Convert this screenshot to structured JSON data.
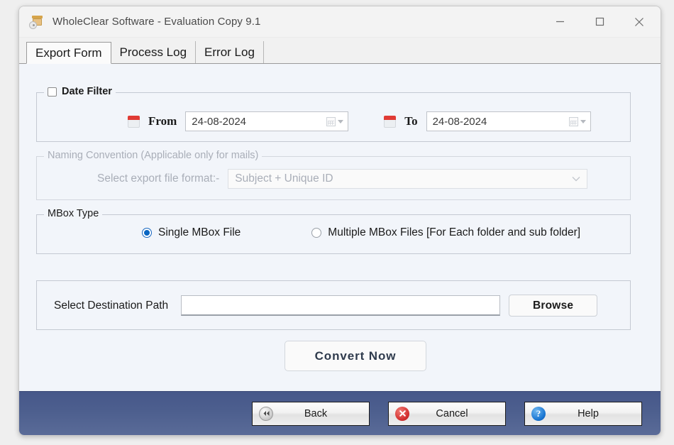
{
  "window": {
    "title": "WholeClear Software - Evaluation Copy 9.1",
    "app_icon": "archive-box-disc-icon",
    "controls": {
      "minimize": "minimize-icon",
      "maximize": "maximize-icon",
      "close": "close-icon"
    }
  },
  "tabs": [
    {
      "label": "Export Form",
      "active": true
    },
    {
      "label": "Process Log",
      "active": false
    },
    {
      "label": "Error Log",
      "active": false
    }
  ],
  "date_filter": {
    "legend": "Date Filter",
    "checked": false,
    "from": {
      "label": "From",
      "value": "24-08-2024",
      "icon": "calendar-icon"
    },
    "to": {
      "label": "To",
      "value": "24-08-2024",
      "icon": "calendar-icon"
    }
  },
  "naming_convention": {
    "legend": "Naming Convention (Applicable only for mails)",
    "disabled": true,
    "field_label": "Select export file format:-",
    "selected_format": "Subject + Unique ID"
  },
  "mbox_type": {
    "legend": "MBox Type",
    "options": [
      {
        "label": "Single MBox File",
        "selected": true
      },
      {
        "label": "Multiple MBox Files [For Each folder and sub folder]",
        "selected": false
      }
    ]
  },
  "destination": {
    "label": "Select Destination Path",
    "value": "",
    "placeholder": "",
    "browse_label": "Browse"
  },
  "convert": {
    "label": "Convert Now"
  },
  "footer": {
    "buttons": [
      {
        "label": "Back",
        "icon": "rewind-icon"
      },
      {
        "label": "Cancel",
        "icon": "cancel-x-icon"
      },
      {
        "label": "Help",
        "icon": "question-mark-icon"
      }
    ]
  },
  "colors": {
    "footer_blue": "#4e608f",
    "accent_radio": "#0a66c2",
    "calendar_red": "#e03b35",
    "content_bg": "#f2f5fa",
    "cancel_red": "#d32f2f",
    "help_blue": "#1976d2"
  }
}
